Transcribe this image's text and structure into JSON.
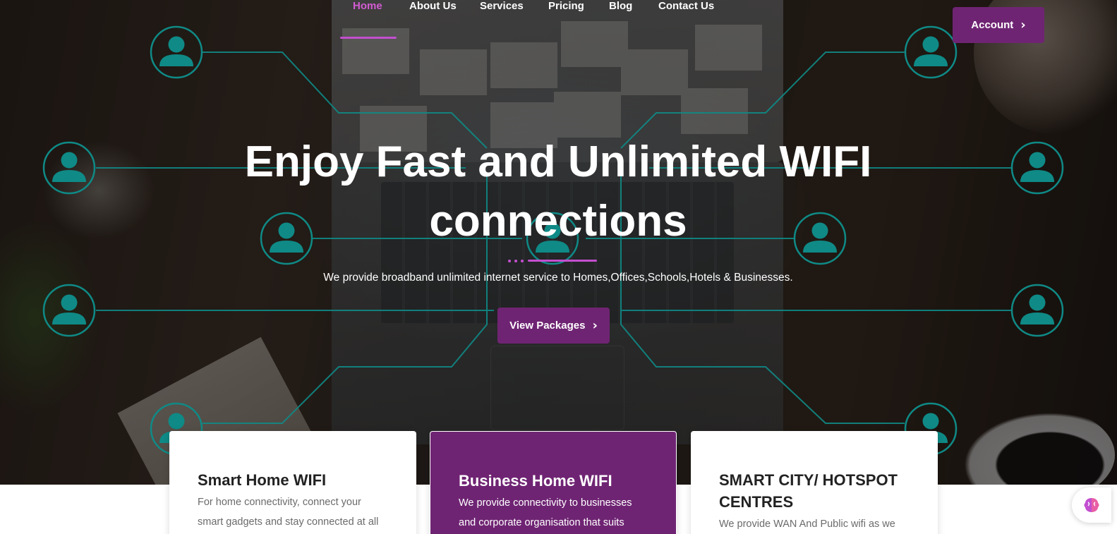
{
  "nav": {
    "items": [
      {
        "label": "Home",
        "active": true
      },
      {
        "label": "About Us",
        "active": false
      },
      {
        "label": "Services",
        "active": false
      },
      {
        "label": "Pricing",
        "active": false
      },
      {
        "label": "Blog",
        "active": false
      },
      {
        "label": "Contact Us",
        "active": false
      }
    ],
    "account_label": "Account",
    "account_icon": "chevron-right-icon"
  },
  "hero": {
    "title_line1": "Enjoy Fast and Unlimited WIFI",
    "title_line2": "connections",
    "subtitle": "We provide broadband unlimited internet service to Homes,Offices,Schools,Hotels & Businesses.",
    "cta_label": "View Packages",
    "cta_icon": "chevron-right-icon"
  },
  "cards": [
    {
      "title": "Smart Home WIFI",
      "text": "For home connectivity, connect your smart gadgets and stay connected at all",
      "featured": false
    },
    {
      "title": "Business Home WIFI",
      "text": "We provide connectivity to businesses and corporate organisation that suits",
      "featured": true
    },
    {
      "title": "SMART CITY/ HOTSPOT CENTRES",
      "text": "We provide WAN And Public wifi as we",
      "featured": false
    }
  ],
  "colors": {
    "brand_purple": "#6f2473",
    "accent_pink": "#c34fcf",
    "network_teal": "#0f8a86"
  },
  "widget": {
    "icon": "brain-icon"
  }
}
